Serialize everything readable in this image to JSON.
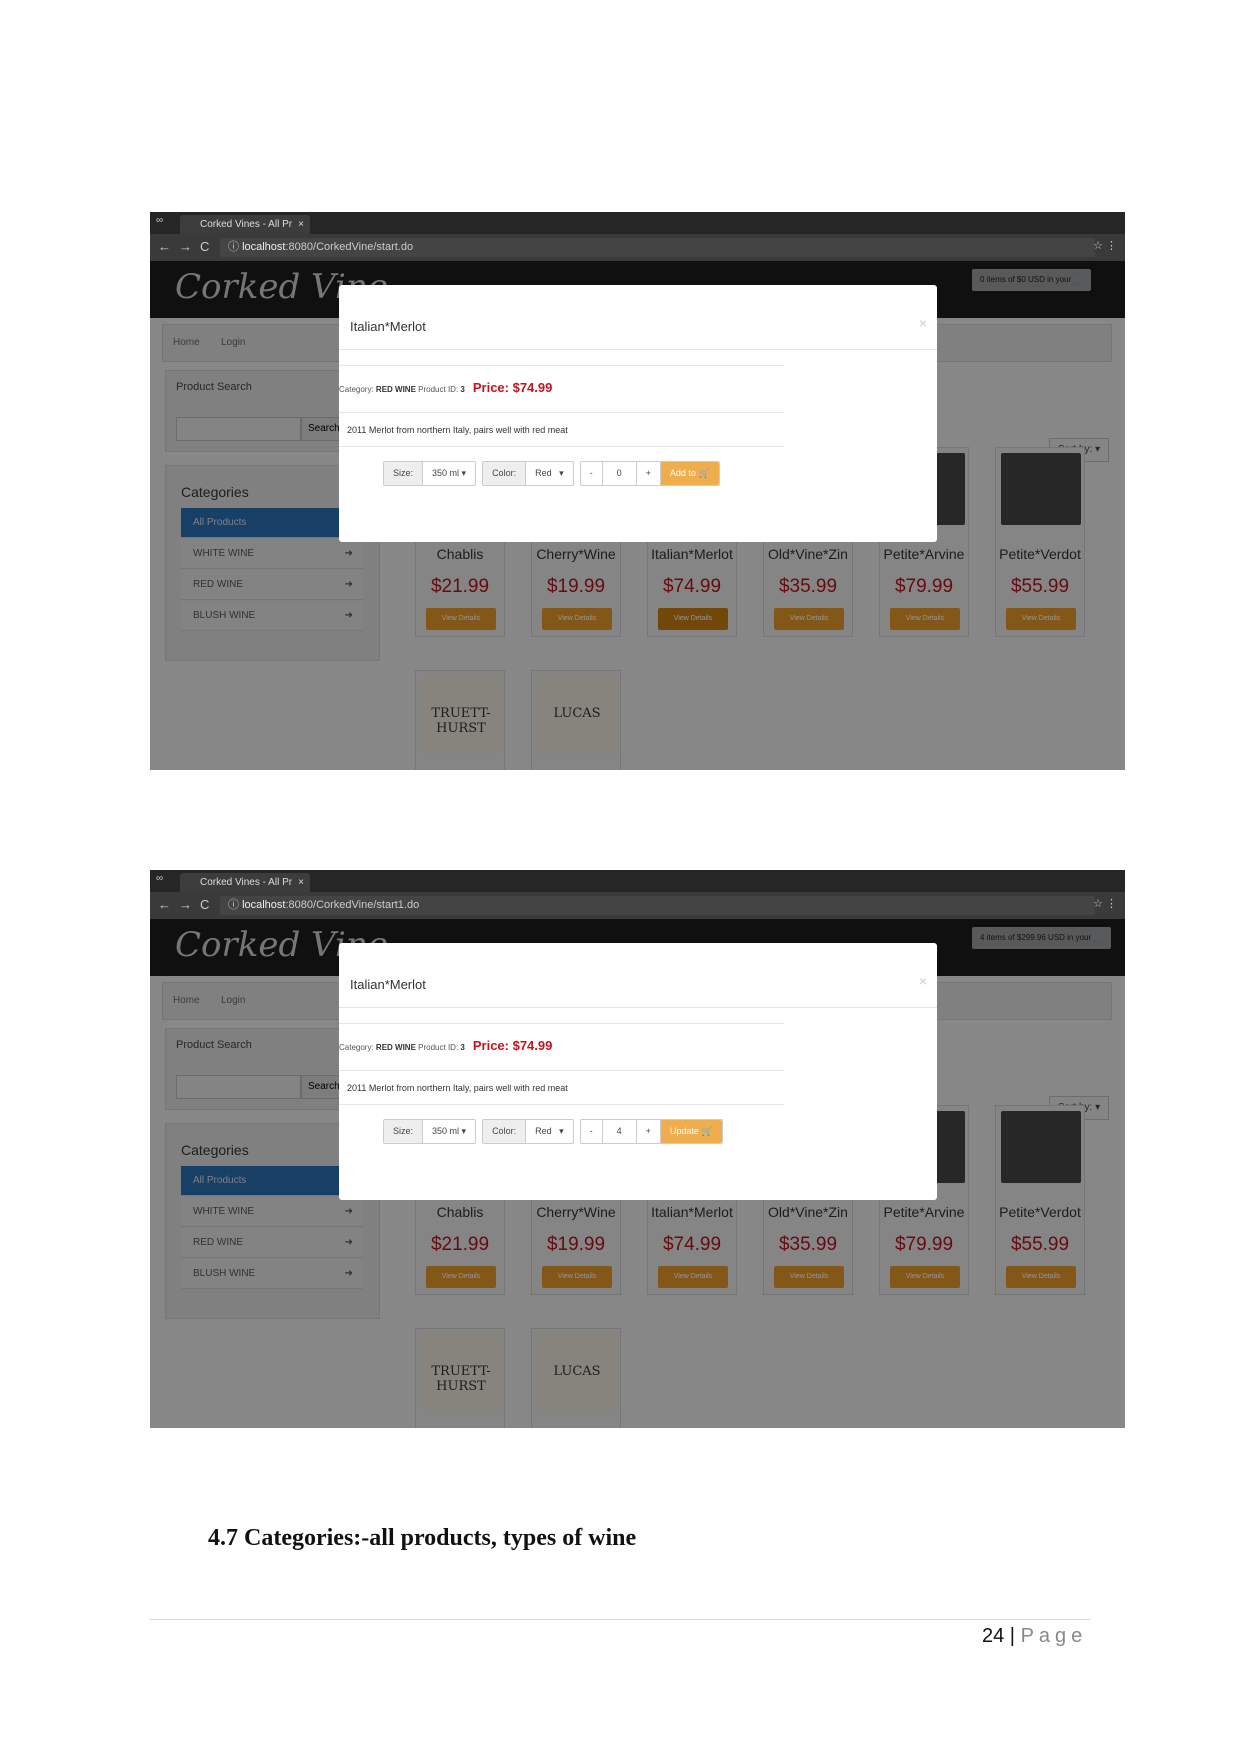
{
  "shots": [
    {
      "tab_title": "Corked Vines - All Pr",
      "url_host": "localhost",
      "url_rest": ":8080/CorkedVine/start.do",
      "logo": "Corked Vine",
      "cart_label": "0 items of $0 USD in your",
      "nav": [
        "Home",
        "Login"
      ],
      "search_title": "Product Search",
      "search_button": "Search",
      "categories_title": "Categories",
      "categories": [
        "All Products",
        "WHITE WINE",
        "RED WINE",
        "BLUSH WINE"
      ],
      "sort_label": "Sort by:",
      "products": [
        {
          "name": "Chablis",
          "price": "$21.99"
        },
        {
          "name": "Cherry*Wine",
          "price": "$19.99"
        },
        {
          "name": "Italian*Merlot",
          "price": "$74.99"
        },
        {
          "name": "Old*Vine*Zin",
          "price": "$35.99"
        },
        {
          "name": "Petite*Arvine",
          "price": "$79.99"
        },
        {
          "name": "Petite*Verdot",
          "price": "$55.99"
        }
      ],
      "view_details": "View Details",
      "row2_labels": [
        "TRUETT-HURST",
        "LUCAS"
      ],
      "modal": {
        "title": "Italian*Merlot",
        "close": "×",
        "category_label": "Category:",
        "category": "RED WINE",
        "product_id_label": "Product ID:",
        "product_id": "3",
        "price": "Price: $74.99",
        "description": "2011 Merlot from northern Italy, pairs well with red meat",
        "size_label": "Size:",
        "size": "350 ml",
        "color_label": "Color:",
        "color": "Red",
        "minus": "-",
        "quantity": "0",
        "plus": "+",
        "action": "Add to"
      }
    },
    {
      "tab_title": "Corked Vines - All Pr",
      "url_host": "localhost",
      "url_rest": ":8080/CorkedVine/start1.do",
      "logo": "Corked Vine",
      "cart_label": "4 items of $299.96 USD in your",
      "nav": [
        "Home",
        "Login"
      ],
      "search_title": "Product Search",
      "search_button": "Search",
      "categories_title": "Categories",
      "categories": [
        "All Products",
        "WHITE WINE",
        "RED WINE",
        "BLUSH WINE"
      ],
      "sort_label": "Sort by:",
      "products": [
        {
          "name": "Chablis",
          "price": "$21.99"
        },
        {
          "name": "Cherry*Wine",
          "price": "$19.99"
        },
        {
          "name": "Italian*Merlot",
          "price": "$74.99"
        },
        {
          "name": "Old*Vine*Zin",
          "price": "$35.99"
        },
        {
          "name": "Petite*Arvine",
          "price": "$79.99"
        },
        {
          "name": "Petite*Verdot",
          "price": "$55.99"
        }
      ],
      "view_details": "View Details",
      "row2_labels": [
        "TRUETT-HURST",
        "LUCAS"
      ],
      "modal": {
        "title": "Italian*Merlot",
        "close": "×",
        "category_label": "Category:",
        "category": "RED WINE",
        "product_id_label": "Product ID:",
        "product_id": "3",
        "price": "Price: $74.99",
        "description": "2011 Merlot from northern Italy, pairs well with red meat",
        "size_label": "Size:",
        "size": "350 ml",
        "color_label": "Color:",
        "color": "Red",
        "minus": "-",
        "quantity": "4",
        "plus": "+",
        "action": "Update"
      }
    }
  ],
  "document": {
    "heading": "4.7 Categories:-all products, types of wine",
    "page_number": "24",
    "page_label": "Page"
  }
}
